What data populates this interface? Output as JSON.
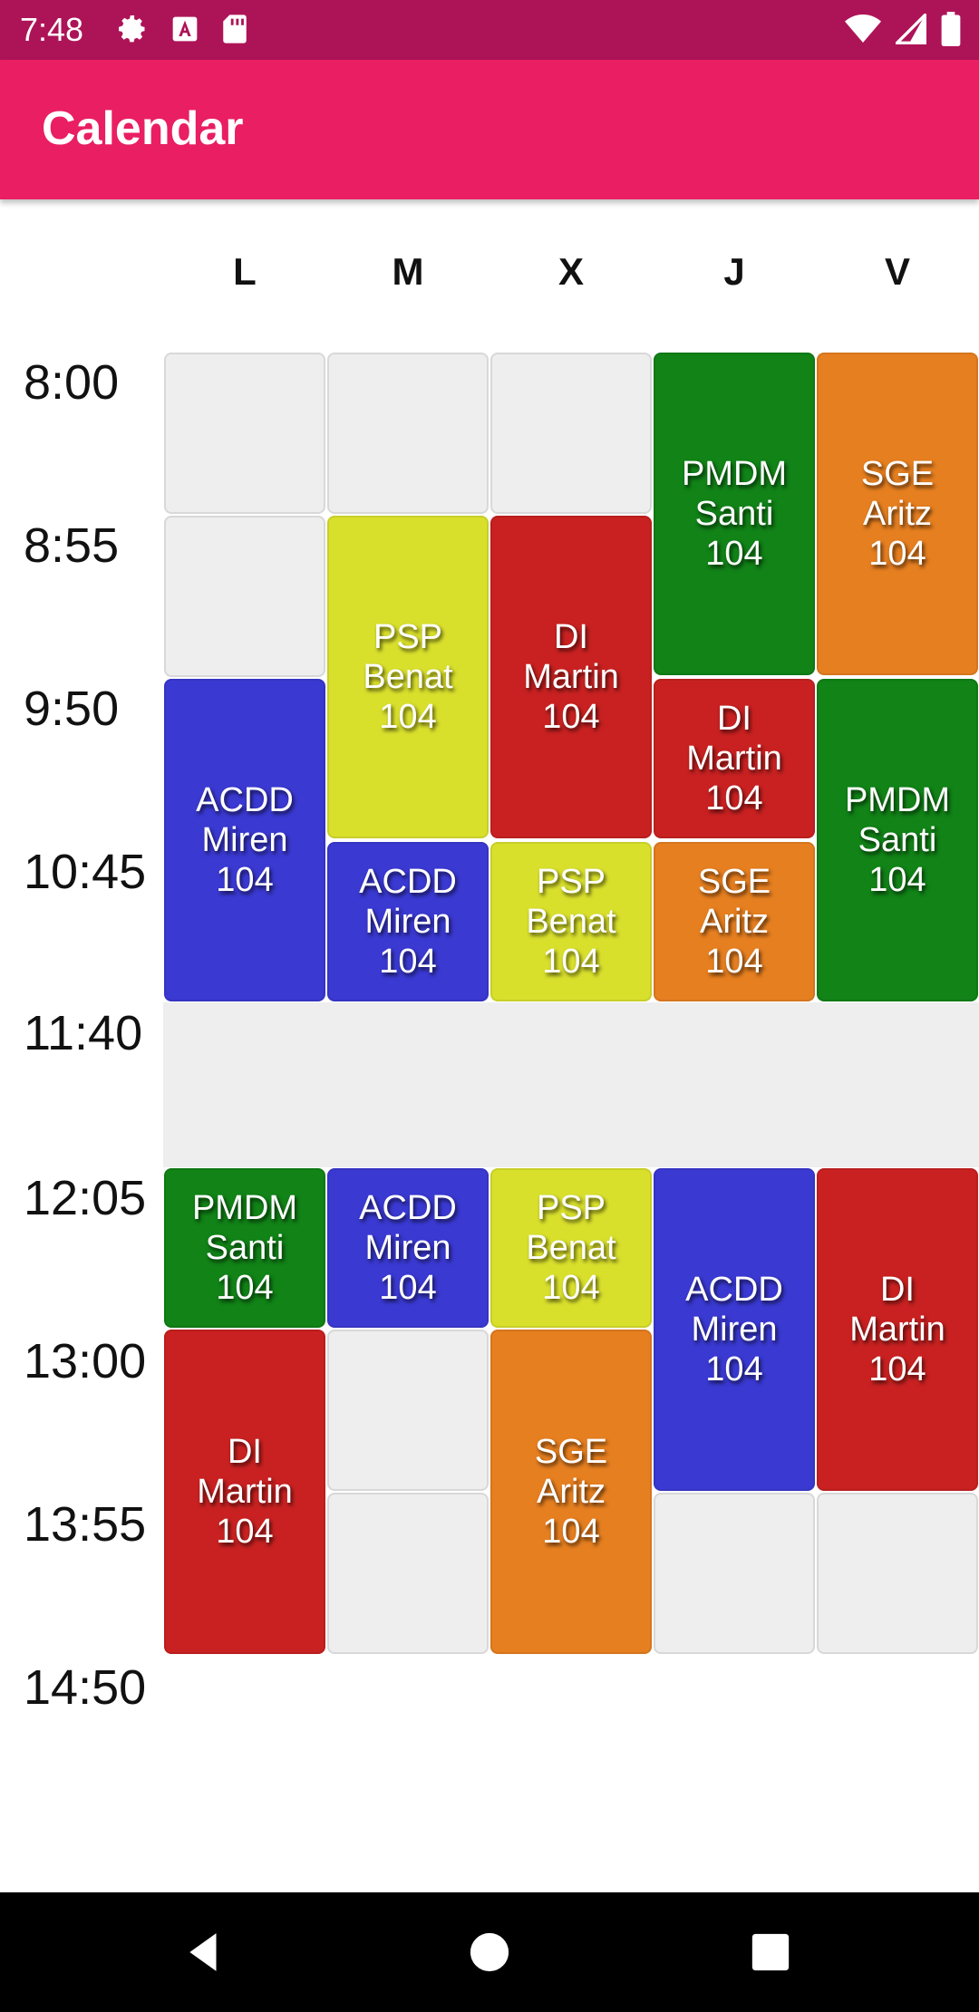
{
  "status_bar": {
    "time": "7:48"
  },
  "app_bar": {
    "title": "Calendar"
  },
  "days": [
    "L",
    "M",
    "X",
    "J",
    "V"
  ],
  "times": [
    "8:00",
    "8:55",
    "9:50",
    "10:45",
    "11:40",
    "12:05",
    "13:00",
    "13:55",
    "14:50"
  ],
  "colors": {
    "green": "#118317",
    "orange": "#e67f20",
    "yellow": "#d9e02c",
    "red": "#c92121",
    "blue": "#3a39d2",
    "empty": "#eeeeee"
  },
  "schedule": {
    "L": [
      {
        "subject": "",
        "teacher": "",
        "room": ""
      },
      {
        "subject": "",
        "teacher": "",
        "room": ""
      },
      {
        "subject": "ACDD",
        "teacher": "Miren",
        "room": "104"
      },
      {
        "subject": "PMDM",
        "teacher": "Santi",
        "room": "104"
      },
      {
        "subject": "DI",
        "teacher": "Martin",
        "room": "104"
      }
    ],
    "M": [
      {
        "subject": "",
        "teacher": "",
        "room": ""
      },
      {
        "subject": "PSP",
        "teacher": "Benat",
        "room": "104"
      },
      {
        "subject": "ACDD",
        "teacher": "Miren",
        "room": "104"
      },
      {
        "subject": "ACDD",
        "teacher": "Miren",
        "room": "104"
      },
      {
        "subject": "",
        "teacher": "",
        "room": ""
      },
      {
        "subject": "",
        "teacher": "",
        "room": ""
      }
    ],
    "X": [
      {
        "subject": "",
        "teacher": "",
        "room": ""
      },
      {
        "subject": "DI",
        "teacher": "Martin",
        "room": "104"
      },
      {
        "subject": "PSP",
        "teacher": "Benat",
        "room": "104"
      },
      {
        "subject": "PSP",
        "teacher": "Benat",
        "room": "104"
      },
      {
        "subject": "SGE",
        "teacher": "Aritz",
        "room": "104"
      }
    ],
    "J": [
      {
        "subject": "PMDM",
        "teacher": "Santi",
        "room": "104"
      },
      {
        "subject": "DI",
        "teacher": "Martin",
        "room": "104"
      },
      {
        "subject": "SGE",
        "teacher": "Aritz",
        "room": "104"
      },
      {
        "subject": "ACDD",
        "teacher": "Miren",
        "room": "104"
      },
      {
        "subject": "",
        "teacher": "",
        "room": ""
      }
    ],
    "V": [
      {
        "subject": "SGE",
        "teacher": "Aritz",
        "room": "104"
      },
      {
        "subject": "PMDM",
        "teacher": "Santi",
        "room": "104"
      },
      {
        "subject": "DI",
        "teacher": "Martin",
        "room": "104"
      },
      {
        "subject": "",
        "teacher": "",
        "room": ""
      }
    ]
  }
}
